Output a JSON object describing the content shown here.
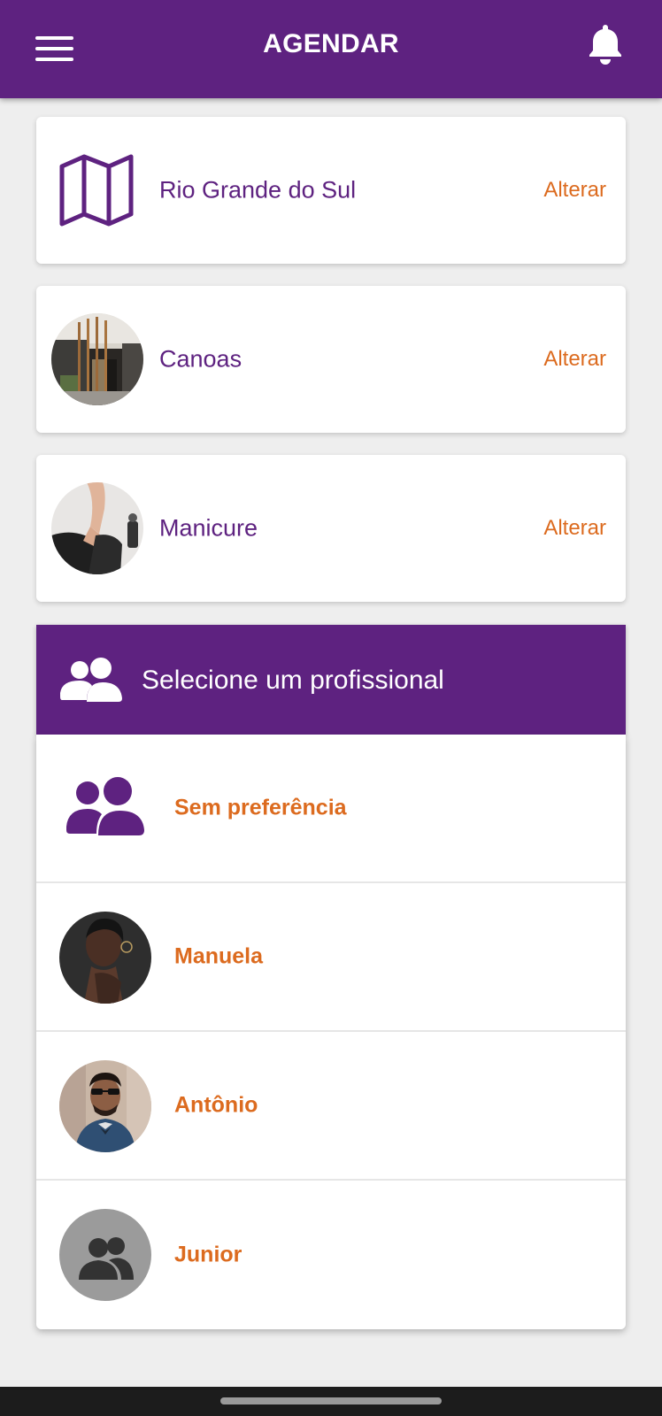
{
  "header": {
    "title": "AGENDAR",
    "menu_icon": "hamburger-menu-icon",
    "notification_icon": "bell-icon"
  },
  "selections": [
    {
      "label": "Rio Grande do Sul",
      "action": "Alterar",
      "icon": "map-icon"
    },
    {
      "label": "Canoas",
      "action": "Alterar",
      "icon": "location-photo"
    },
    {
      "label": "Manicure",
      "action": "Alterar",
      "icon": "service-photo"
    }
  ],
  "professionals": {
    "title": "Selecione um profissional",
    "header_icon": "users-icon",
    "items": [
      {
        "name": "Sem preferência",
        "icon": "users-icon"
      },
      {
        "name": "Manuela",
        "icon": "avatar-photo"
      },
      {
        "name": "Antônio",
        "icon": "avatar-photo"
      },
      {
        "name": "Junior",
        "icon": "default-avatar-icon"
      }
    ]
  },
  "colors": {
    "primary": "#5e2280",
    "accent": "#dc6b1f",
    "background": "#eeeeee"
  }
}
